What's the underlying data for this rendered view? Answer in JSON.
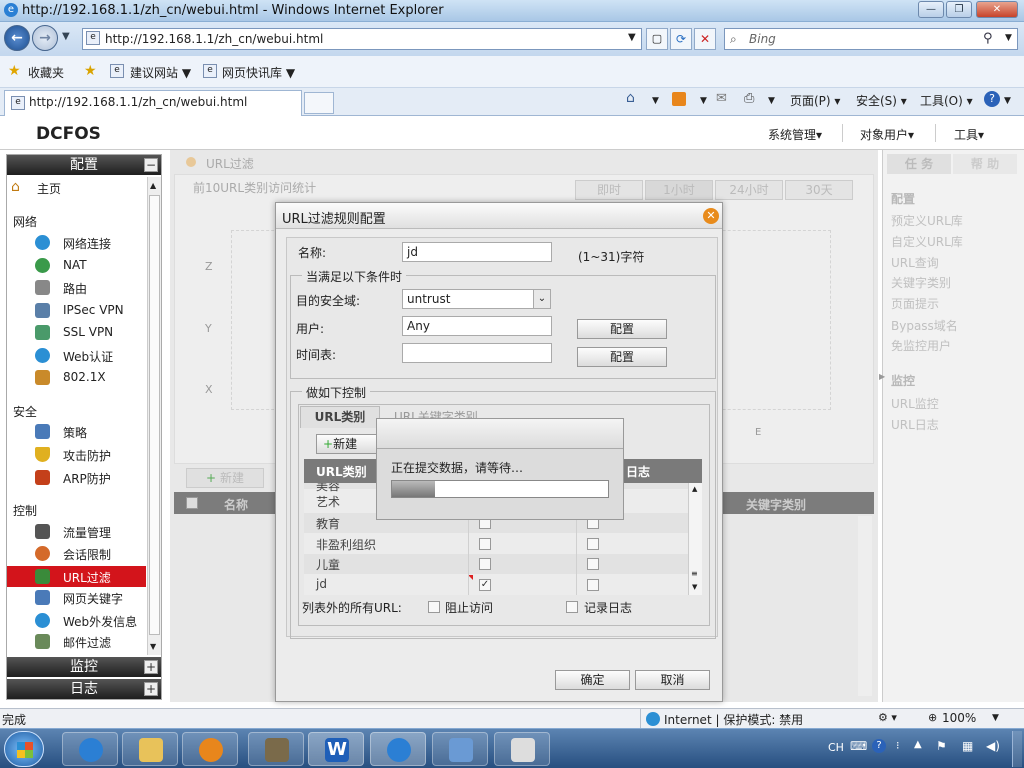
{
  "window": {
    "title": "http://192.168.1.1/zh_cn/webui.html - Windows Internet Explorer"
  },
  "browser": {
    "address": "http://192.168.1.1/zh_cn/webui.html",
    "search_placeholder": "Bing",
    "favorites": "收藏夹",
    "suggested_sites": "建议网站 ▼",
    "web_slice": "网页快讯库 ▼",
    "tab_title": "http://192.168.1.1/zh_cn/webui.html",
    "tools": {
      "page": "页面(P) ▾",
      "safety": "安全(S) ▾",
      "tools": "工具(O) ▾"
    }
  },
  "app": {
    "logo": "DCFOS",
    "menu": [
      "系统管理▾",
      "对象用户▾",
      "工具▾"
    ]
  },
  "sidebar": {
    "config_header": "配置",
    "home": "主页",
    "groups": {
      "network": "网络",
      "security": "安全",
      "control": "控制"
    },
    "network_items": [
      "网络连接",
      "NAT",
      "路由",
      "IPSec VPN",
      "SSL VPN",
      "Web认证",
      "802.1X"
    ],
    "security_items": [
      "策略",
      "攻击防护",
      "ARP防护"
    ],
    "control_items": [
      "流量管理",
      "会话限制",
      "URL过滤",
      "网页关键字",
      "Web外发信息",
      "邮件过滤"
    ],
    "monitor_header": "监控",
    "log_header": "日志"
  },
  "main": {
    "breadcrumb": "URL过滤",
    "chart_title": "前10URL类别访问统计",
    "time_tabs": [
      "即时",
      "1小时",
      "24小时",
      "30天"
    ],
    "axis_labels": [
      "Z",
      "Y",
      "X",
      "E"
    ],
    "new_button": "新建",
    "col_name": "名称",
    "col_keyword_cat": "关键字类别"
  },
  "tasks": {
    "tab_task": "任 务",
    "tab_help": "帮 助",
    "config_label": "配置",
    "config_items": [
      "预定义URL库",
      "自定义URL库",
      "URL查询",
      "关键字类别",
      "页面提示",
      "Bypass域名",
      "免监控用户"
    ],
    "monitor_label": "监控",
    "monitor_items": [
      "URL监控",
      "URL日志"
    ]
  },
  "dialog": {
    "title": "URL过滤规则配置",
    "name_label": "名称:",
    "name_value": "jd",
    "name_hint": "(1~31)字符",
    "cond_legend": "当满足以下条件时",
    "zone_label": "目的安全域:",
    "zone_value": "untrust",
    "user_label": "用户:",
    "user_value": "Any",
    "time_label": "时间表:",
    "config_btn": "配置",
    "action_legend": "做如下控制",
    "tab_url_cat": "URL类别",
    "tab_url_kw": "URL关键字类别",
    "new_btn": "新建",
    "col_url_cat": "URL类别",
    "col_log": "日志",
    "rows": [
      {
        "name": "美容",
        "block": false,
        "log": false
      },
      {
        "name": "艺术",
        "block": false,
        "log": false
      },
      {
        "name": "教育",
        "block": false,
        "log": false
      },
      {
        "name": "非盈利组织",
        "block": false,
        "log": false
      },
      {
        "name": "儿童",
        "block": false,
        "log": false
      },
      {
        "name": "jd",
        "block": true,
        "log": false
      }
    ],
    "others_label": "列表外的所有URL:",
    "block_label": "阻止访问",
    "log_label": "记录日志",
    "ok": "确定",
    "cancel": "取消"
  },
  "modal": {
    "message": "正在提交数据，请等待…",
    "progress": 0.2
  },
  "statusbar": {
    "left": "完成",
    "zone": "Internet | 保护模式: 禁用",
    "zoom": "100%"
  },
  "taskbar": {
    "lang": "CH"
  }
}
